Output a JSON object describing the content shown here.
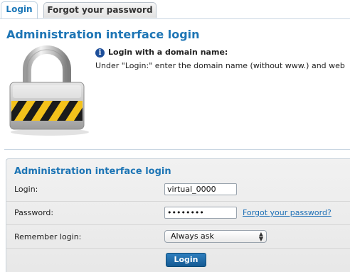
{
  "tabs": [
    {
      "label": "Login",
      "active": true
    },
    {
      "label": "Forgot your password",
      "active": false
    }
  ],
  "header": {
    "title": "Administration interface login"
  },
  "info": {
    "icon": "info-icon",
    "title": "Login with a domain name:",
    "text": "Under \"Login:\" enter the domain name (without www.) and web"
  },
  "form": {
    "title": "Administration interface login",
    "login_label": "Login:",
    "login_value": "virtual_0000",
    "password_label": "Password:",
    "password_value": "••••••••",
    "forgot_link": "Forgot your password?",
    "remember_label": "Remember login:",
    "remember_value": "Always ask",
    "submit_label": "Login"
  },
  "colors": {
    "accent": "#1d75b5",
    "button": "#1a6aa8",
    "link": "#1c6fb6"
  }
}
